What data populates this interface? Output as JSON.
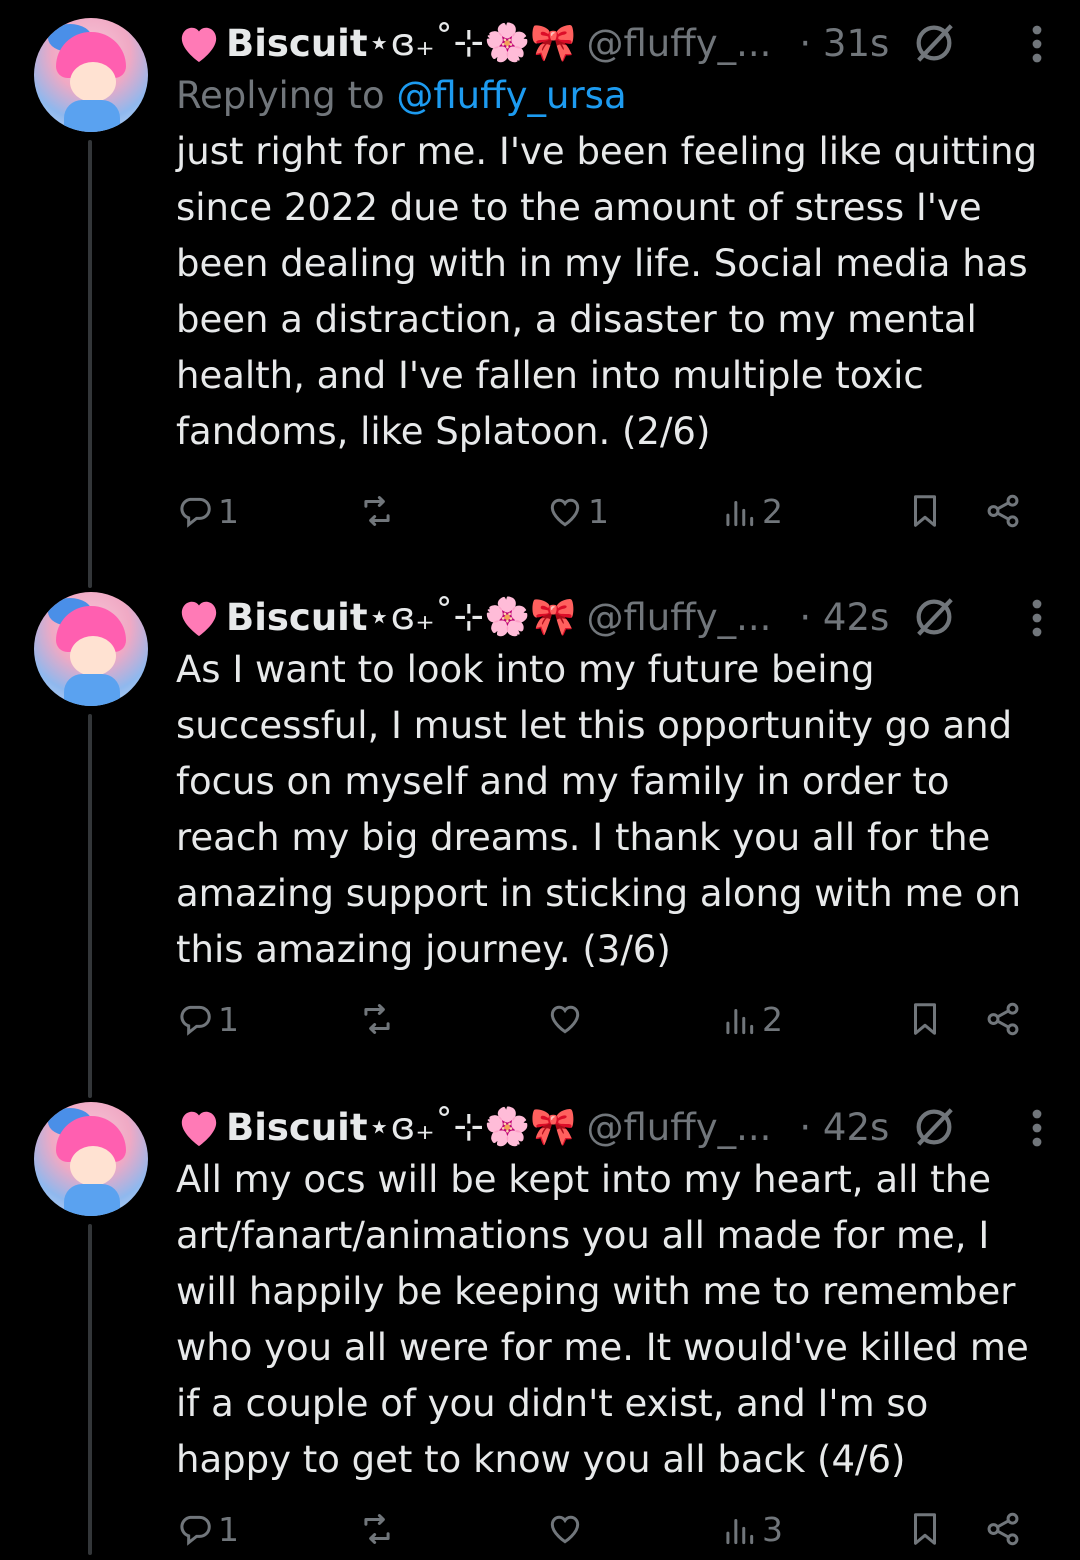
{
  "tweets": [
    {
      "name": "Biscuit",
      "name_deco": "⋆ɞ₊˚⊹🌸🎀",
      "handle": "@fluffy_...",
      "time": "· 31s",
      "replying_prefix": "Replying to ",
      "replying_handle": "@fluffy_ursa",
      "text": "just right for me. I've been feeling like quitting\nsince 2022 due to the amount of stress I've\nbeen dealing with in my life. Social media has\nbeen a distraction, a disaster to my mental\nhealth, and I've fallen into multiple toxic\nfandoms, like Splatoon. (2/6)",
      "replies": "1",
      "reposts": "",
      "likes": "1",
      "views": "2"
    },
    {
      "name": "Biscuit",
      "name_deco": "⋆ɞ₊˚⊹🌸🎀",
      "handle": "@fluffy_...",
      "time": "· 42s",
      "text": "As I want to look into my future being\nsuccessful, I must let this opportunity go and\nfocus on myself and my family in order to\nreach my big dreams. I thank you all for the\namazing support in sticking along with me on\nthis amazing journey. (3/6)",
      "replies": "1",
      "reposts": "",
      "likes": "",
      "views": "2"
    },
    {
      "name": "Biscuit",
      "name_deco": "⋆ɞ₊˚⊹🌸🎀",
      "handle": "@fluffy_...",
      "time": "· 42s",
      "text": "All my ocs will be kept into my heart, all the\nart/fanart/animations you all made for me, I\nwill happily be keeping with me to remember\nwho you all were for me. It would've killed me\nif a couple of you didn't exist, and I'm so\nhappy to get to know you all back (4/6)",
      "replies": "1",
      "reposts": "",
      "likes": "",
      "views": "3"
    }
  ],
  "colors": {
    "background": "#000000",
    "text": "#e7e9ea",
    "muted": "#71767b",
    "link": "#1d9bf0",
    "heart": "#ff7ab6"
  },
  "icons": [
    "reply-icon",
    "repost-icon",
    "like-icon",
    "views-icon",
    "bookmark-icon",
    "share-icon",
    "grok-icon",
    "more-icon"
  ]
}
